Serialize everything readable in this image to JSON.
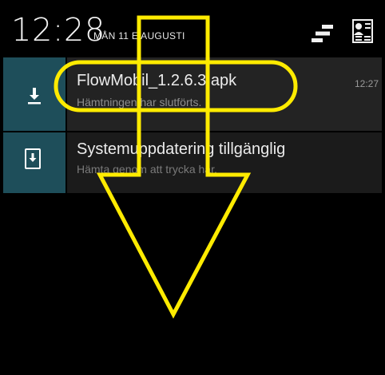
{
  "status": {
    "clock": "12:28",
    "date": "MÅN 11 E AUGUSTI",
    "icons": [
      "settings-icon",
      "quick-settings-icon"
    ]
  },
  "notifications": [
    {
      "title": "FlowMobil_1.2.6.3.apk",
      "text": "Hämtningen har slutförts.",
      "time": "12:27",
      "icon": "download-icon"
    },
    {
      "title": "Systemuppdatering tillgänglig",
      "text": "Hämta genom att trycka här.",
      "icon": "system-update-icon"
    }
  ],
  "colors": {
    "background": "#000000",
    "icon_box": "#1e4e5a",
    "notif_bg": "#232323",
    "annotation": "#ffeb00"
  },
  "annotation": {
    "shape": "downward-arrow",
    "highlight": "ellipse around first notification"
  }
}
